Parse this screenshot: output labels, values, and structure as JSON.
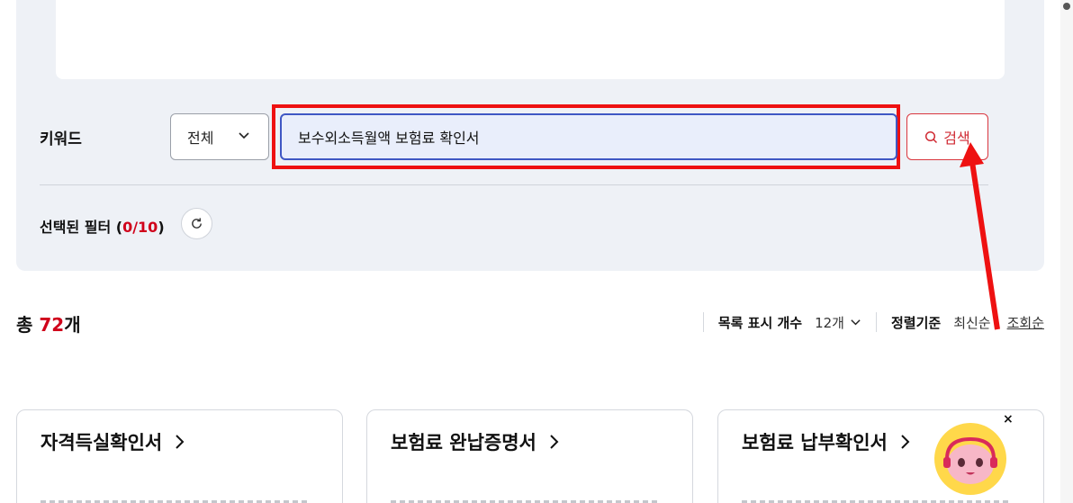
{
  "keyword_section": {
    "label": "키워드",
    "select_value": "전체",
    "search_value": "보수외소득월액 보험료 확인서",
    "search_button_label": "검색"
  },
  "selected_filter": {
    "label": "선택된 필터 (",
    "count": "0/10",
    "close": ")"
  },
  "results": {
    "total_prefix": "총 ",
    "total_count": "72",
    "total_suffix": "개"
  },
  "list_controls": {
    "display_label": "목록 표시 개수",
    "display_value": "12개",
    "sort_label": "정렬기준",
    "sort_options": [
      "최신순",
      "조회순"
    ]
  },
  "cards": [
    {
      "title": "자격득실확인서"
    },
    {
      "title": "보험료 완납증명서"
    },
    {
      "title": "보험료 납부확인서"
    }
  ],
  "mascot": {
    "close_label": "×"
  },
  "colors": {
    "accent": "#d0021b",
    "highlight": "#ee1111",
    "input_border": "#3f57c4"
  }
}
